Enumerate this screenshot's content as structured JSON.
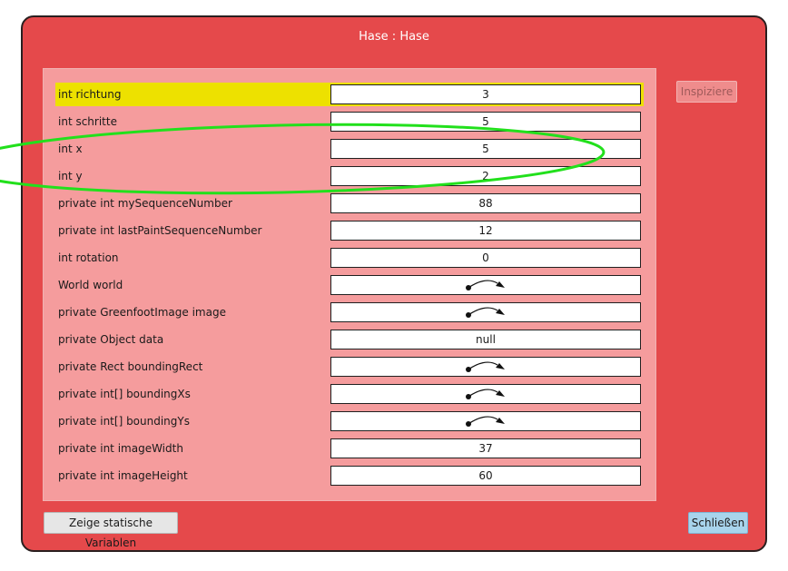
{
  "window": {
    "title": "Hase : Hase"
  },
  "fields": [
    {
      "name": "int richtung",
      "value": "3",
      "type": "text",
      "selected": true
    },
    {
      "name": "int schritte",
      "value": "5",
      "type": "text"
    },
    {
      "name": "int x",
      "value": "5",
      "type": "text"
    },
    {
      "name": "int y",
      "value": "2",
      "type": "text"
    },
    {
      "name": "private int mySequenceNumber",
      "value": "88",
      "type": "text"
    },
    {
      "name": "private int lastPaintSequenceNumber",
      "value": "12",
      "type": "text"
    },
    {
      "name": "int rotation",
      "value": "0",
      "type": "text"
    },
    {
      "name": "World world",
      "value": null,
      "type": "reference"
    },
    {
      "name": "private GreenfootImage image",
      "value": null,
      "type": "reference"
    },
    {
      "name": "private Object data",
      "value": "null",
      "type": "text"
    },
    {
      "name": "private Rect boundingRect",
      "value": null,
      "type": "reference"
    },
    {
      "name": "private int[] boundingXs",
      "value": null,
      "type": "reference"
    },
    {
      "name": "private int[] boundingYs",
      "value": null,
      "type": "reference"
    },
    {
      "name": "private int imageWidth",
      "value": "37",
      "type": "text"
    },
    {
      "name": "private int imageHeight",
      "value": "60",
      "type": "text"
    }
  ],
  "buttons": {
    "inspect_label": "Inspiziere",
    "static_label": "Zeige statische Variablen",
    "close_label": "Schließen"
  },
  "colors": {
    "window_bg": "#e5494b",
    "panel_bg": "#f59c9d",
    "selected_row": "#ede100",
    "annotation_ellipse": "#22e01c"
  },
  "icons": {
    "reference": "object-reference-arrow-icon"
  }
}
